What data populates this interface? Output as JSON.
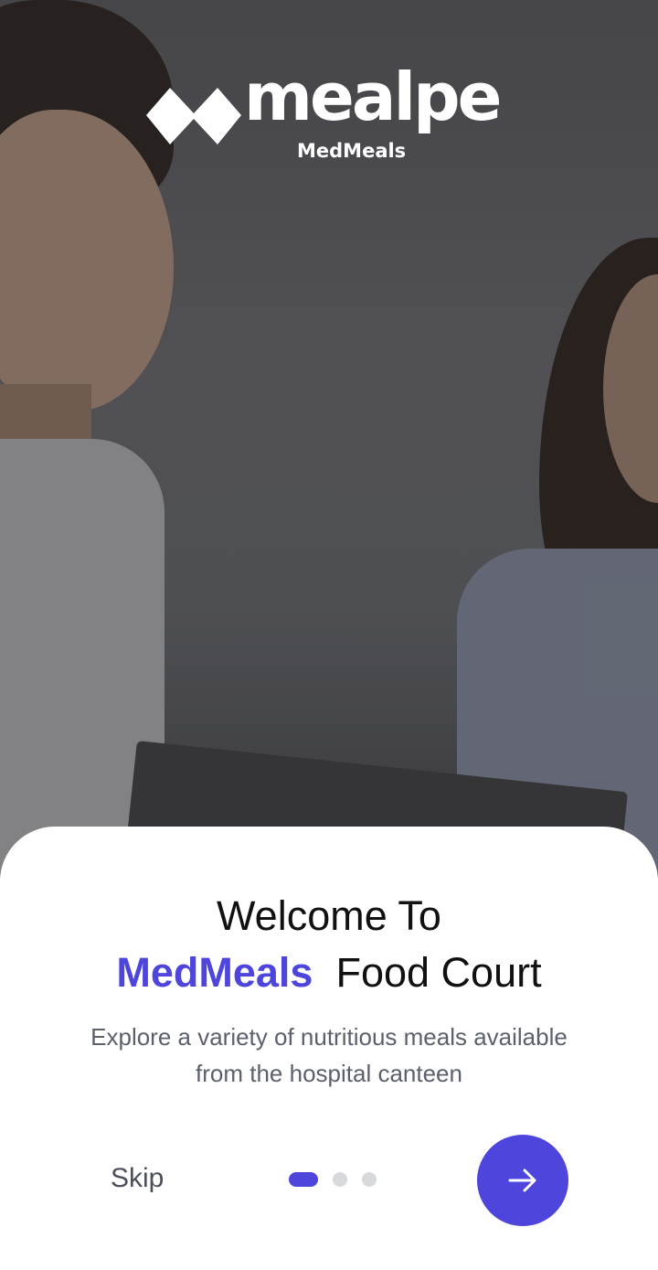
{
  "logo": {
    "wordmark": "mealpe",
    "subtitle": "MedMeals",
    "icon": "mealpe-logo-mark"
  },
  "welcome": {
    "line1": "Welcome To",
    "accent": "MedMeals",
    "line2_rest": "Food Court",
    "description": "Explore a variety of nutritious meals available from the hospital canteen"
  },
  "controls": {
    "skip_label": "Skip",
    "next_icon": "arrow-right-icon",
    "page_total": 3,
    "page_current": 1
  },
  "colors": {
    "accent": "#4e46dc",
    "dot_inactive": "#d8d9dc",
    "title": "#111111",
    "description": "#5b616c"
  },
  "hero": {
    "image": "two-women-in-hospital-photo"
  }
}
